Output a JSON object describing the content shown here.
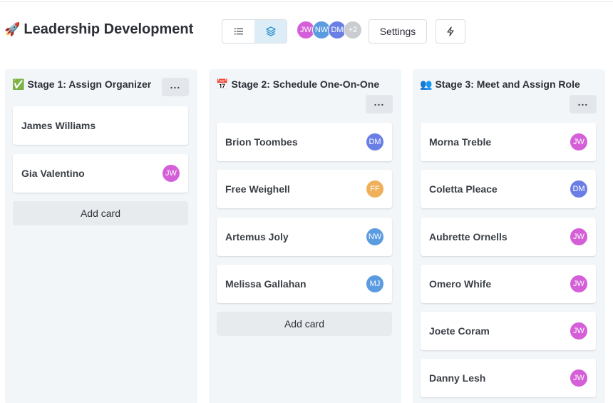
{
  "header": {
    "emoji": "🚀",
    "title": "Leadership Development",
    "settings_label": "Settings",
    "avatars": [
      {
        "initials": "JW",
        "color": "#d45fd8"
      },
      {
        "initials": "NW",
        "color": "#5b9be0"
      },
      {
        "initials": "DM",
        "color": "#6a7fe6"
      },
      {
        "initials": "+2",
        "color": "#c9ccd1"
      }
    ],
    "icons": {
      "list": "list-icon",
      "board": "layers-icon",
      "automation": "lightning-icon",
      "more": "ellipsis-icon"
    }
  },
  "columns": [
    {
      "emoji": "✅",
      "title": "Stage 1: Assign Organizer",
      "cards": [
        {
          "name": "James Williams",
          "initials": "",
          "color": ""
        },
        {
          "name": "Gia Valentino",
          "initials": "JW",
          "color": "#d45fd8"
        }
      ],
      "add_label": "Add card"
    },
    {
      "emoji": "📅",
      "title": "Stage 2: Schedule One-On-One",
      "cards": [
        {
          "name": "Brion Toombes",
          "initials": "DM",
          "color": "#6a7fe6"
        },
        {
          "name": "Free Weighell",
          "initials": "FF",
          "color": "#f0b05a"
        },
        {
          "name": "Artemus Joly",
          "initials": "NW",
          "color": "#5b9be0"
        },
        {
          "name": "Melissa Gallahan",
          "initials": "MJ",
          "color": "#5b9be0"
        }
      ],
      "add_label": "Add card"
    },
    {
      "emoji": "👥",
      "title": "Stage 3: Meet and Assign Role",
      "cards": [
        {
          "name": "Morna Treble",
          "initials": "JW",
          "color": "#d45fd8"
        },
        {
          "name": "Coletta Pleace",
          "initials": "DM",
          "color": "#6a7fe6"
        },
        {
          "name": "Aubrette Ornells",
          "initials": "JW",
          "color": "#d45fd8"
        },
        {
          "name": "Omero Whife",
          "initials": "JW",
          "color": "#d45fd8"
        },
        {
          "name": "Joete Coram",
          "initials": "JW",
          "color": "#d45fd8"
        },
        {
          "name": "Danny Lesh",
          "initials": "JW",
          "color": "#d45fd8"
        }
      ],
      "add_label": ""
    }
  ]
}
